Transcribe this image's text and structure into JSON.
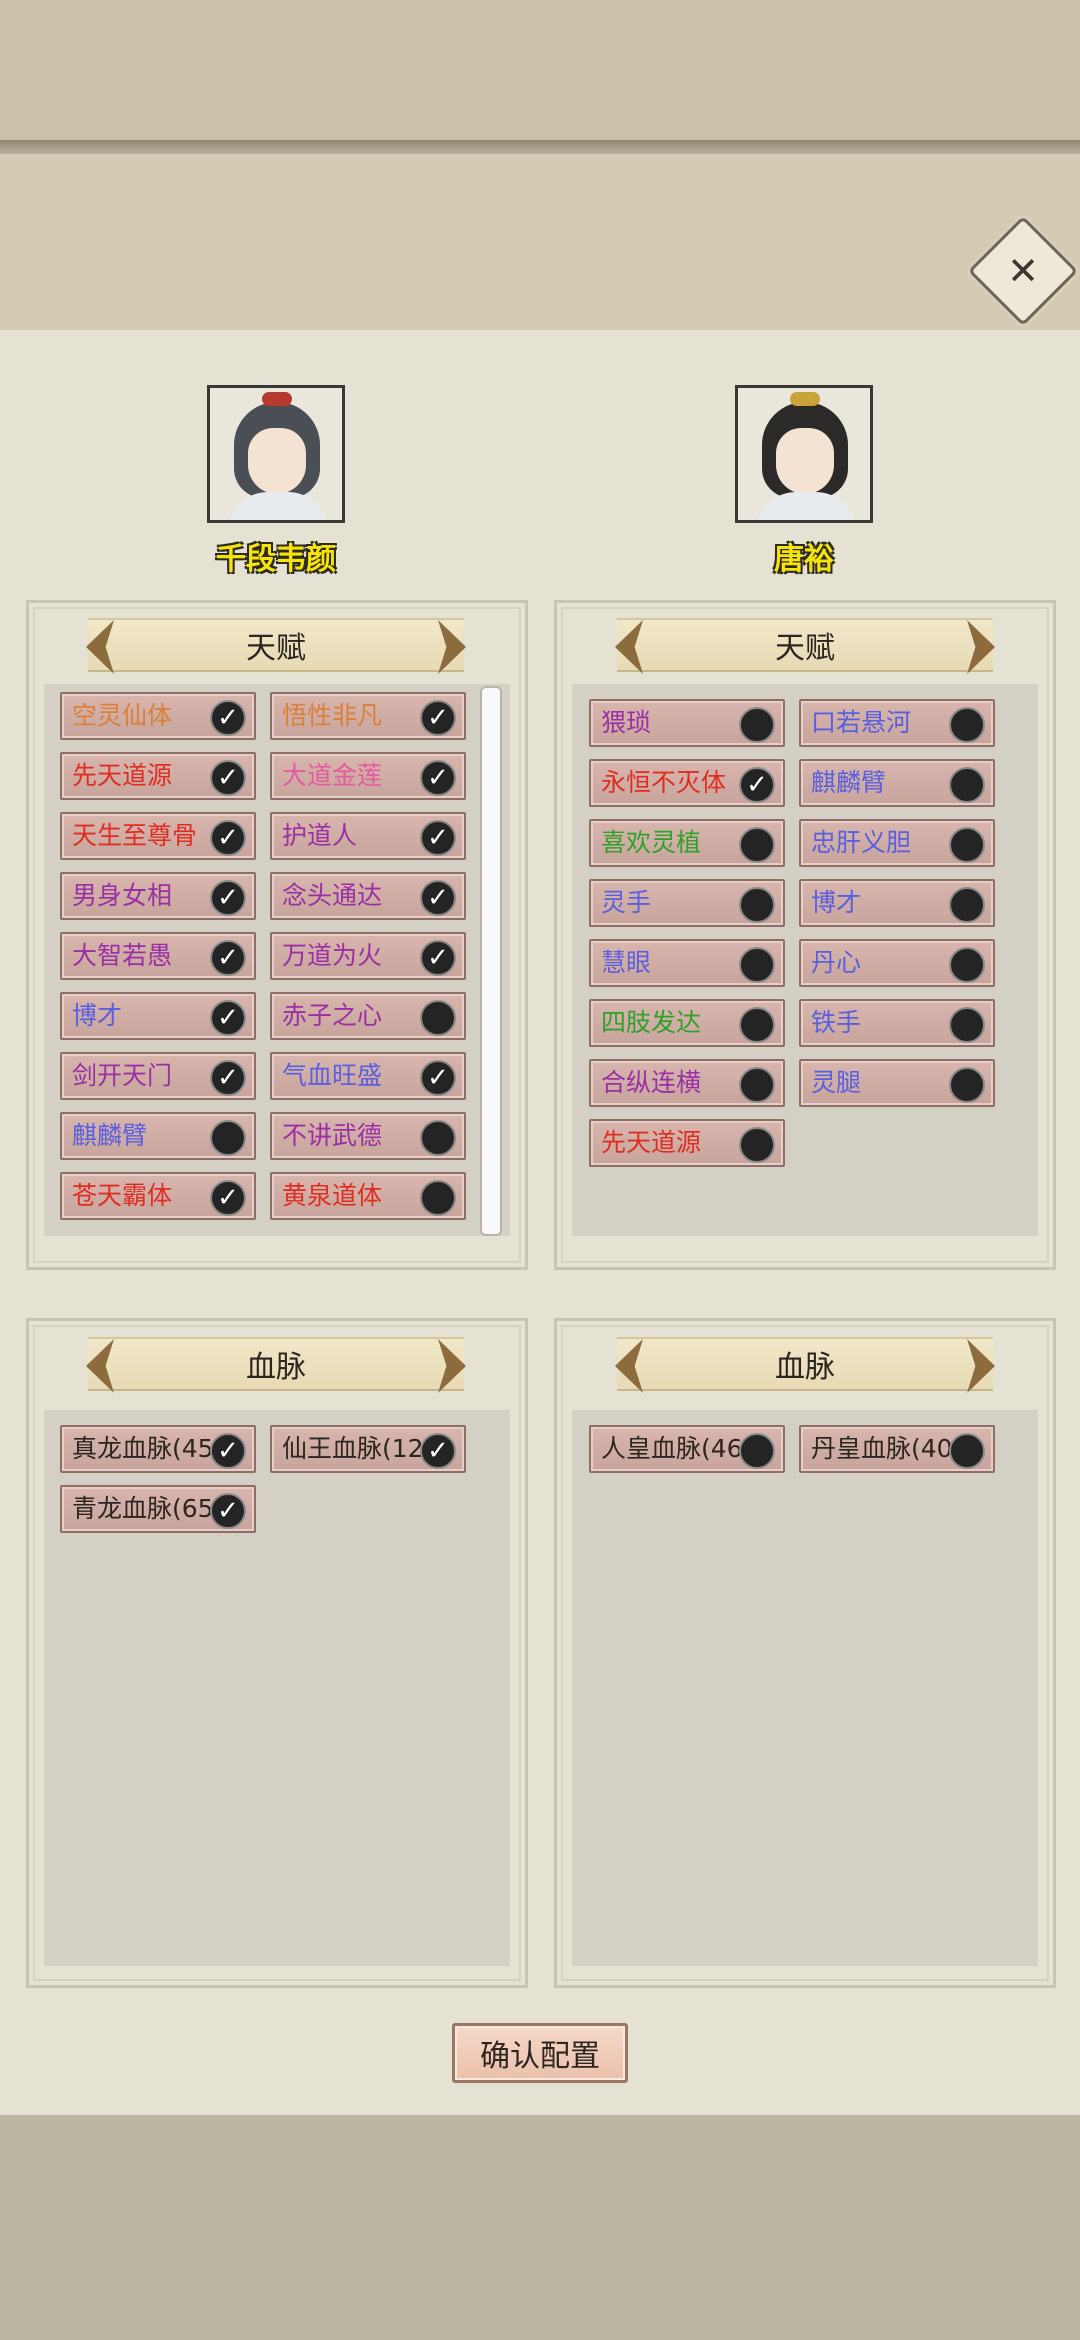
{
  "colors": {
    "orange": "#d9813a",
    "red": "#e02d22",
    "pink": "#e55aa0",
    "purple": "#9b2fa5",
    "blue": "#5a5fe0",
    "green": "#2fa12a",
    "name_yellow": "#f4e40c"
  },
  "icons": {
    "close": "close-icon",
    "checked": "check-toggle-icon",
    "unchecked": "empty-toggle-icon",
    "arrow_left": "arrow-left-icon",
    "arrow_right": "arrow-right-icon"
  },
  "left": {
    "name": "千段韦颜",
    "talent_header": "天赋",
    "bloodline_header": "血脉",
    "talents": [
      {
        "label": "空灵仙体",
        "color": "orange",
        "checked": true
      },
      {
        "label": "悟性非凡",
        "color": "orange",
        "checked": true
      },
      {
        "label": "先天道源",
        "color": "red",
        "checked": true
      },
      {
        "label": "大道金莲",
        "color": "pink",
        "checked": true
      },
      {
        "label": "天生至尊骨",
        "color": "red",
        "checked": true
      },
      {
        "label": "护道人",
        "color": "purple",
        "checked": true
      },
      {
        "label": "男身女相",
        "color": "purple",
        "checked": true
      },
      {
        "label": "念头通达",
        "color": "purple",
        "checked": true
      },
      {
        "label": "大智若愚",
        "color": "purple",
        "checked": true
      },
      {
        "label": "万道为火",
        "color": "purple",
        "checked": true
      },
      {
        "label": "博才",
        "color": "blue",
        "checked": true
      },
      {
        "label": "赤子之心",
        "color": "purple",
        "checked": false
      },
      {
        "label": "剑开天门",
        "color": "purple",
        "checked": true
      },
      {
        "label": "气血旺盛",
        "color": "blue",
        "checked": true
      },
      {
        "label": "麒麟臂",
        "color": "blue",
        "checked": false
      },
      {
        "label": "不讲武德",
        "color": "purple",
        "checked": false
      },
      {
        "label": "苍天霸体",
        "color": "red",
        "checked": true
      },
      {
        "label": "黄泉道体",
        "color": "red",
        "checked": false
      }
    ],
    "bloodlines": [
      {
        "label": "真龙血脉(45",
        "checked": true
      },
      {
        "label": "仙王血脉(12",
        "checked": true
      },
      {
        "label": "青龙血脉(65",
        "checked": true
      }
    ]
  },
  "right": {
    "name": "唐裕",
    "talent_header": "天赋",
    "bloodline_header": "血脉",
    "talents": [
      {
        "label": "猥琐",
        "color": "purple",
        "checked": false
      },
      {
        "label": "口若悬河",
        "color": "blue",
        "checked": false
      },
      {
        "label": "永恒不灭体",
        "color": "red",
        "checked": true
      },
      {
        "label": "麒麟臂",
        "color": "blue",
        "checked": false
      },
      {
        "label": "喜欢灵植",
        "color": "green",
        "checked": false
      },
      {
        "label": "忠肝义胆",
        "color": "blue",
        "checked": false
      },
      {
        "label": "灵手",
        "color": "blue",
        "checked": false
      },
      {
        "label": "博才",
        "color": "blue",
        "checked": false
      },
      {
        "label": "慧眼",
        "color": "blue",
        "checked": false
      },
      {
        "label": "丹心",
        "color": "blue",
        "checked": false
      },
      {
        "label": "四肢发达",
        "color": "green",
        "checked": false
      },
      {
        "label": "铁手",
        "color": "blue",
        "checked": false
      },
      {
        "label": "合纵连横",
        "color": "purple",
        "checked": false
      },
      {
        "label": "灵腿",
        "color": "blue",
        "checked": false
      },
      {
        "label": "先天道源",
        "color": "red",
        "checked": false
      }
    ],
    "bloodlines": [
      {
        "label": "人皇血脉(46)",
        "checked": false
      },
      {
        "label": "丹皇血脉(40)",
        "checked": false
      }
    ]
  },
  "confirm_label": "确认配置"
}
